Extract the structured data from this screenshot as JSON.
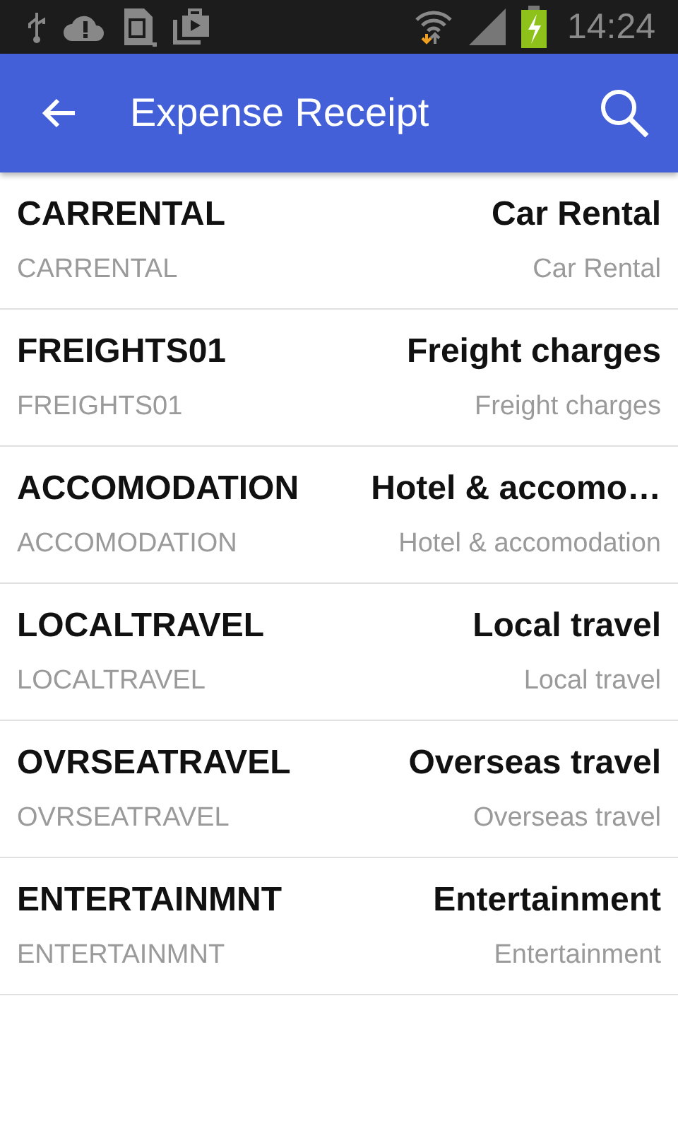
{
  "status_bar": {
    "time": "14:24"
  },
  "app_bar": {
    "title": "Expense Receipt"
  },
  "items": [
    {
      "code": "CARRENTAL",
      "name": "Car Rental",
      "sub_code": "CARRENTAL",
      "sub_name": "Car Rental"
    },
    {
      "code": "FREIGHTS01",
      "name": "Freight charges",
      "sub_code": "FREIGHTS01",
      "sub_name": "Freight charges"
    },
    {
      "code": "ACCOMODATION",
      "name": "Hotel & accomo…",
      "sub_code": "ACCOMODATION",
      "sub_name": "Hotel & accomodation"
    },
    {
      "code": "LOCALTRAVEL",
      "name": "Local travel",
      "sub_code": "LOCALTRAVEL",
      "sub_name": "Local travel"
    },
    {
      "code": "OVRSEATRAVEL",
      "name": "Overseas travel",
      "sub_code": "OVRSEATRAVEL",
      "sub_name": "Overseas travel"
    },
    {
      "code": "ENTERTAINMNT",
      "name": "Entertainment",
      "sub_code": "ENTERTAINMNT",
      "sub_name": "Entertainment"
    }
  ]
}
